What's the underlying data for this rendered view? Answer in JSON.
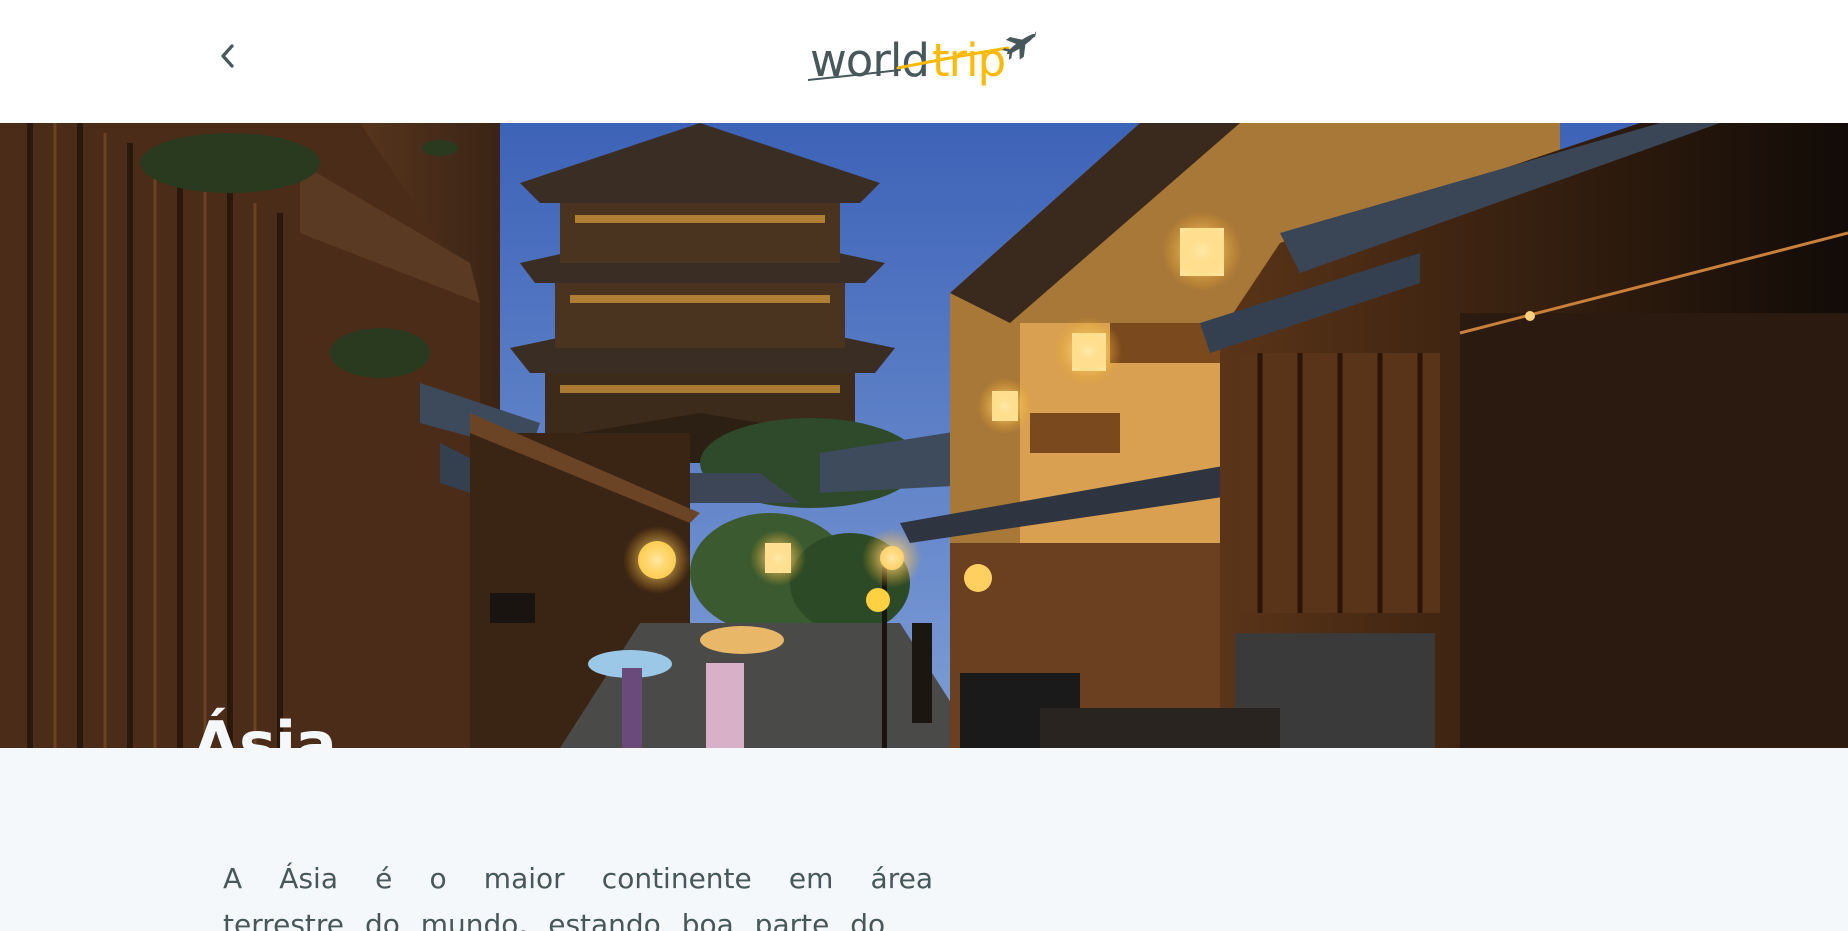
{
  "header": {
    "back_icon": "chevron-left-icon",
    "logo": {
      "part1": "world",
      "part2": "trip",
      "icon": "airplane-icon"
    }
  },
  "hero": {
    "title": "Ásia"
  },
  "content": {
    "description": "A Ásia é o maior continente em área terrestre do mundo, estando boa parte do"
  },
  "colors": {
    "dark_text": "#47585b",
    "accent": "#ffba08",
    "light_bg": "#f5f8fa",
    "highlight": "#4cb68f"
  }
}
